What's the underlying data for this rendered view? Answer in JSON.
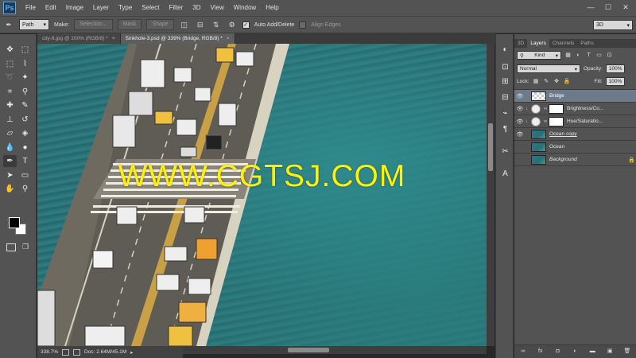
{
  "app": {
    "logo": "Ps"
  },
  "menu": [
    "File",
    "Edit",
    "Image",
    "Layer",
    "Type",
    "Select",
    "Filter",
    "3D",
    "View",
    "Window",
    "Help"
  ],
  "window_controls": {
    "minimize": "—",
    "maximize": "☐",
    "close": "✕"
  },
  "options_bar": {
    "tool_mode": "Path",
    "make_label": "Make:",
    "selection_btn": "Selection...",
    "mask_btn": "Mask",
    "shape_btn": "Shape",
    "auto_add_delete_label": "Auto Add/Delete",
    "auto_add_delete_checked": true,
    "align_edges_label": "Align Edges",
    "align_edges_checked": false
  },
  "workspace": "3D",
  "document_tabs": [
    {
      "label": "city-8.jpg @ 100% (RGB/8) *",
      "active": false
    },
    {
      "label": "Sinkhole-3.psd @ 339% (Bridge, RGB/8) *",
      "active": true
    }
  ],
  "canvas": {
    "watermark": "WWW.CGTSJ.COM"
  },
  "status_bar": {
    "zoom": "338.7%",
    "doc_info": "Doc: 2.64M/45.1M"
  },
  "panel": {
    "tabs": [
      {
        "label": "3D",
        "active": false
      },
      {
        "label": "Layers",
        "active": true
      },
      {
        "label": "Channels",
        "active": false
      },
      {
        "label": "Paths",
        "active": false
      }
    ],
    "filter_kind": "Kind",
    "blend_mode": "Normal",
    "opacity_label": "Opacity:",
    "opacity_value": "100%",
    "lock_label": "Lock:",
    "fill_label": "Fill:",
    "fill_value": "100%",
    "layers": [
      {
        "name": "Bridge",
        "visible": true,
        "selected": true,
        "type": "pixel"
      },
      {
        "name": "Brightness/Co...",
        "visible": true,
        "selected": false,
        "type": "adjustment"
      },
      {
        "name": "Hue/Saturatio...",
        "visible": true,
        "selected": false,
        "type": "adjustment"
      },
      {
        "name": "Ocean copy",
        "visible": true,
        "selected": false,
        "type": "image"
      },
      {
        "name": "Ocean",
        "visible": false,
        "selected": false,
        "type": "image"
      },
      {
        "name": "Background",
        "visible": false,
        "selected": false,
        "type": "background"
      }
    ]
  }
}
